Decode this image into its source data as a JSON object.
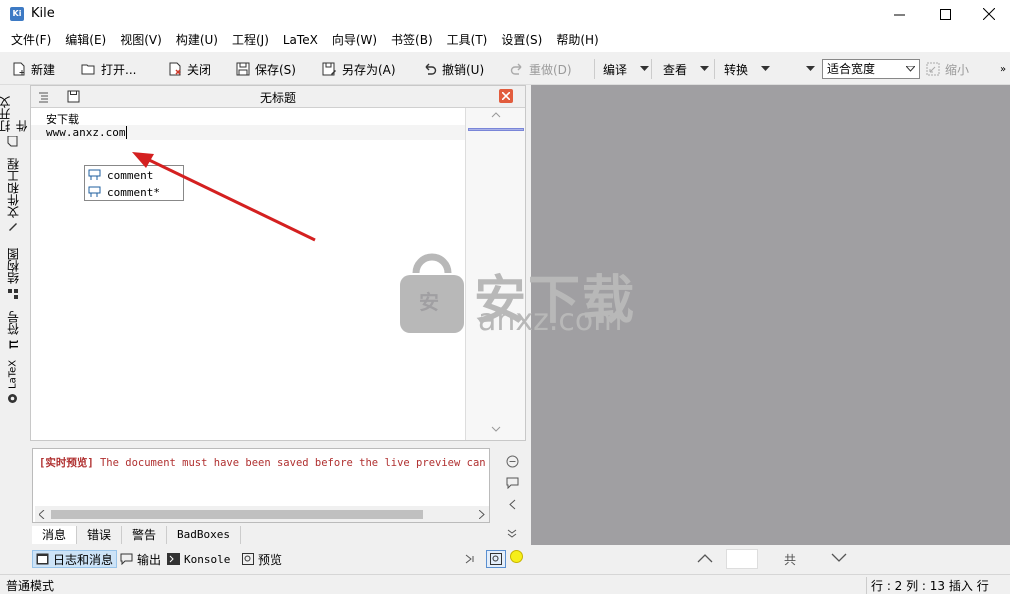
{
  "window": {
    "title": "Kile",
    "app_icon_label": "Ki"
  },
  "menu": [
    "文件(F)",
    "编辑(E)",
    "视图(V)",
    "构建(U)",
    "工程(J)",
    "LaTeX",
    "向导(W)",
    "书签(B)",
    "工具(T)",
    "设置(S)",
    "帮助(H)"
  ],
  "toolbar": {
    "new": "新建",
    "open": "打开...",
    "close": "关闭",
    "save": "保存(S)",
    "save_as": "另存为(A)",
    "undo": "撤销(U)",
    "redo": "重做(D)",
    "compile": "编译",
    "view": "查看",
    "convert": "转换",
    "zoom_mode": "适合宽度",
    "zoom_out": "缩小"
  },
  "side_tabs": [
    "打开文件",
    "文件和工程",
    "结构图",
    "符号",
    "LaTeX"
  ],
  "editor": {
    "doc_title": "无标题",
    "lines": [
      "安下载",
      "www.anxz.com"
    ],
    "completion": [
      "comment",
      "comment*"
    ]
  },
  "messages": {
    "live_preview_tag": "[实时预览]",
    "live_preview_text": "The document must have been saved before the live preview can b",
    "tabs": [
      "消息",
      "错误",
      "警告",
      "BadBoxes"
    ]
  },
  "bottom_tools": {
    "log": "日志和消息",
    "output": "输出",
    "konsole": "Konsole",
    "preview": "预览"
  },
  "preview": {
    "of_label": "共",
    "watermark": "安下载",
    "watermark_sub": "anxz.com"
  },
  "status": {
    "mode": "普通模式",
    "position": "行 : 2 列 : 13  插入  行"
  },
  "colors": {
    "accent": "#3d7ac4",
    "close_red": "#e25c3d",
    "preview_bg": "#a09fa2",
    "message_red": "#b03030"
  }
}
